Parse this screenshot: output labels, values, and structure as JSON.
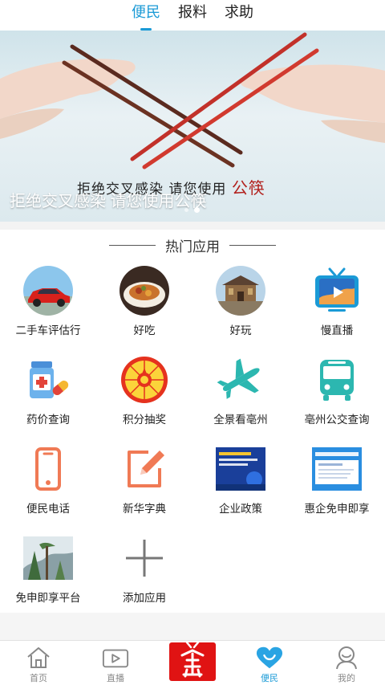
{
  "top_tabs": [
    {
      "label": "便民",
      "active": true
    },
    {
      "label": "报料",
      "active": false
    },
    {
      "label": "求助",
      "active": false
    }
  ],
  "banner": {
    "caption": "拒绝交叉感染 请您使用公筷",
    "image_text": "拒绝交叉感染  请您使用",
    "image_text_red": "公筷",
    "dots": 2,
    "active_dot": 2
  },
  "section": {
    "title": "热门应用"
  },
  "apps": [
    {
      "label": "二手车评估行",
      "icon": "car-photo-icon"
    },
    {
      "label": "好吃",
      "icon": "food-photo-icon"
    },
    {
      "label": "好玩",
      "icon": "landmark-photo-icon"
    },
    {
      "label": "慢直播",
      "icon": "tv-live-icon"
    },
    {
      "label": "药价查询",
      "icon": "medicine-icon"
    },
    {
      "label": "积分抽奖",
      "icon": "prize-wheel-icon"
    },
    {
      "label": "全景看亳州",
      "icon": "airplane-icon"
    },
    {
      "label": "亳州公交查询",
      "icon": "bus-icon"
    },
    {
      "label": "便民电话",
      "icon": "phone-icon"
    },
    {
      "label": "新华字典",
      "icon": "dictionary-edit-icon"
    },
    {
      "label": "企业政策",
      "icon": "policy-thumbnail-icon"
    },
    {
      "label": "惠企免申即享",
      "icon": "benefit-thumbnail-icon"
    },
    {
      "label": "免申即享平台",
      "icon": "landscape-photo-icon"
    },
    {
      "label": "添加应用",
      "icon": "plus-icon"
    }
  ],
  "bottom_nav": [
    {
      "label": "首页",
      "icon": "home-icon",
      "active": false
    },
    {
      "label": "直播",
      "icon": "video-icon",
      "active": false
    },
    {
      "label": "",
      "icon": "app-logo-icon",
      "active": false
    },
    {
      "label": "便民",
      "icon": "heart-icon",
      "active": true
    },
    {
      "label": "我的",
      "icon": "user-icon",
      "active": false
    }
  ],
  "colors": {
    "accent": "#1a9ad6",
    "teal_icon": "#2cb7b0",
    "orange_icon": "#f07a55",
    "logo_red": "#e01313"
  }
}
